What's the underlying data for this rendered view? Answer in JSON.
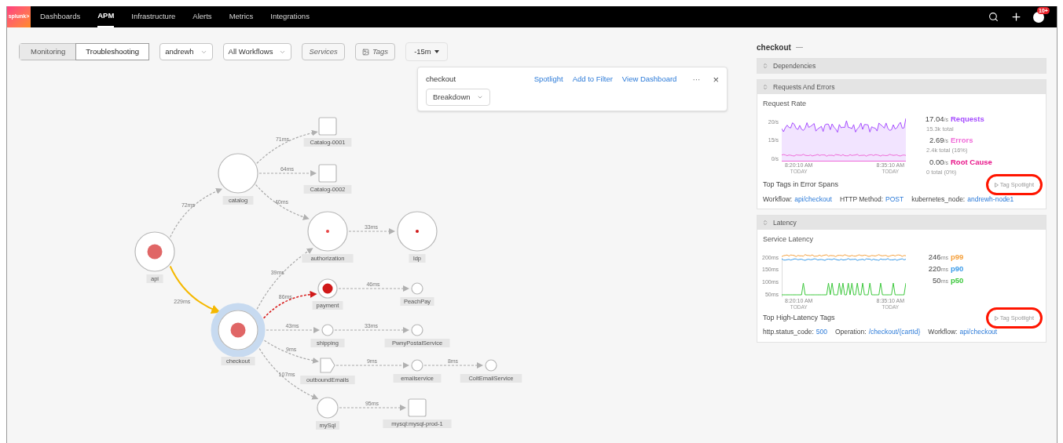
{
  "nav": {
    "logo": "splunk>",
    "items": [
      {
        "label": "Dashboards",
        "selected": false
      },
      {
        "label": "APM",
        "selected": true
      },
      {
        "label": "Infrastructure",
        "selected": false
      },
      {
        "label": "Alerts",
        "selected": false
      },
      {
        "label": "Metrics",
        "selected": false
      },
      {
        "label": "Integrations",
        "selected": false
      }
    ],
    "notifications": "10+"
  },
  "toolbar": {
    "modes": [
      {
        "label": "Monitoring",
        "selected": false
      },
      {
        "label": "Troubleshooting",
        "selected": true
      }
    ],
    "filters": [
      {
        "kind": "dropdown",
        "label": "andrewh"
      },
      {
        "kind": "dropdown",
        "label": "All Workflows"
      },
      {
        "kind": "toggle",
        "label": "Services"
      },
      {
        "kind": "icon-toggle",
        "label": "Tags"
      },
      {
        "kind": "menu",
        "label": "-15m"
      }
    ]
  },
  "popup": {
    "title": "checkout",
    "links": [
      "Spotlight",
      "Add to Filter",
      "View Dashboard"
    ],
    "more": "···",
    "close": "×",
    "breakdown": "Breakdown"
  },
  "map": {
    "nodes": [
      {
        "name": "api",
        "kind": "service",
        "color": "#e06666",
        "selected": false
      },
      {
        "name": "catalog",
        "kind": "service",
        "selected": false
      },
      {
        "name": "Catalog-0001",
        "kind": "database",
        "selected": false
      },
      {
        "name": "Catalog-0002",
        "kind": "database",
        "selected": false
      },
      {
        "name": "authorization",
        "kind": "service",
        "color": "#e84444",
        "selected": false
      },
      {
        "name": "ldp",
        "kind": "service",
        "color": "#d01818",
        "selected": false
      },
      {
        "name": "checkout",
        "kind": "service",
        "color": "#e06666",
        "selected": true
      },
      {
        "name": "payment",
        "kind": "service",
        "color": "#d01818",
        "selected": false
      },
      {
        "name": "PeachPay",
        "kind": "service",
        "selected": false
      },
      {
        "name": "shipping",
        "kind": "service",
        "selected": false
      },
      {
        "name": "PwnyPostalService",
        "kind": "service",
        "selected": false
      },
      {
        "name": "outboundEmails",
        "kind": "queue",
        "selected": false
      },
      {
        "name": "emailservice",
        "kind": "service",
        "selected": false
      },
      {
        "name": "ColtEmailService",
        "kind": "service",
        "selected": false
      },
      {
        "name": "mySql",
        "kind": "service",
        "selected": false
      },
      {
        "name": "mysql:mysql-prod-1",
        "kind": "database",
        "selected": false
      }
    ],
    "edges": [
      {
        "latency": "72ms",
        "kind": "normal"
      },
      {
        "latency": "229ms",
        "kind": "slow"
      },
      {
        "latency": "71ms",
        "kind": "normal"
      },
      {
        "latency": "64ms",
        "kind": "normal"
      },
      {
        "latency": "40ms",
        "kind": "normal"
      },
      {
        "latency": "33ms",
        "kind": "normal"
      },
      {
        "latency": "39ms",
        "kind": "normal"
      },
      {
        "latency": "86ms",
        "kind": "error"
      },
      {
        "latency": "46ms",
        "kind": "normal"
      },
      {
        "latency": "43ms",
        "kind": "normal"
      },
      {
        "latency": "33ms",
        "kind": "normal"
      },
      {
        "latency": "9ms",
        "kind": "normal"
      },
      {
        "latency": "9ms",
        "kind": "normal"
      },
      {
        "latency": "8ms",
        "kind": "normal"
      },
      {
        "latency": "107ms",
        "kind": "normal"
      },
      {
        "latency": "95ms",
        "kind": "normal"
      }
    ]
  },
  "panel": {
    "title": "checkout",
    "title_suffix": "—",
    "sections": [
      {
        "title": "Dependencies",
        "expanded": false
      },
      {
        "title": "Requests And Errors",
        "expanded": true,
        "kind": "requests",
        "chart_title": "Request Rate",
        "y_labels": [
          "20/s",
          "15/s",
          "0/s"
        ],
        "x_labels": [
          {
            "time": "8:20:10 AM",
            "day": "TODAY"
          },
          {
            "time": "8:35:10 AM",
            "day": "TODAY"
          }
        ],
        "stats": [
          {
            "value": "17.04",
            "unit": "/s",
            "label": "Requests",
            "color": "#a64dff",
            "sub": "15.3k total"
          },
          {
            "value": "2.69",
            "unit": "/s",
            "label": "Errors",
            "color": "#f06ad8",
            "sub": "2.4k total (16%)"
          },
          {
            "value": "0.00",
            "unit": "/s",
            "label": "Root Cause",
            "color": "#e8168a",
            "sub": "0 total (0%)"
          }
        ],
        "tags_title": "Top Tags in Error Spans",
        "spotlight": {
          "label": "Tag Spotlight",
          "highlighted": true
        },
        "tags": [
          {
            "key": "Workflow:",
            "value": "api/checkout"
          },
          {
            "key": "HTTP Method:",
            "value": "POST"
          },
          {
            "key": "kubernetes_node:",
            "value": "andrewh-node1"
          }
        ]
      },
      {
        "title": "Latency",
        "expanded": true,
        "kind": "latency",
        "chart_title": "Service Latency",
        "y_labels": [
          "200ms",
          "150ms",
          "100ms",
          "50ms"
        ],
        "x_labels": [
          {
            "time": "8:20:10 AM",
            "day": "TODAY"
          },
          {
            "time": "8:35:10 AM",
            "day": "TODAY"
          }
        ],
        "stats": [
          {
            "value": "246",
            "unit": "ms",
            "label": "p99",
            "color": "#f5a03c"
          },
          {
            "value": "220",
            "unit": "ms",
            "label": "p90",
            "color": "#3c9be8"
          },
          {
            "value": "50",
            "unit": "ms",
            "label": "p50",
            "color": "#3cc83c"
          }
        ],
        "tags_title": "Top High-Latency Tags",
        "spotlight": {
          "label": "Tag Spotlight",
          "highlighted": true
        },
        "tags": [
          {
            "key": "http.status_code:",
            "value": "500"
          },
          {
            "key": "Operation:",
            "value": "/checkout/{cartId}"
          },
          {
            "key": "Workflow:",
            "value": "api/checkout"
          }
        ]
      }
    ]
  }
}
